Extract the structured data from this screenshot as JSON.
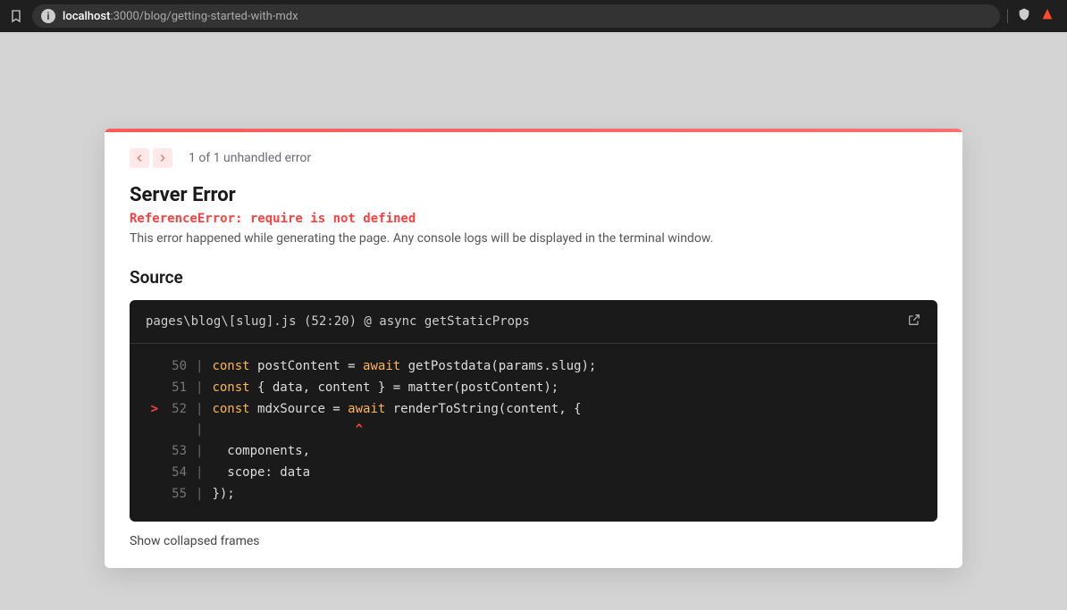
{
  "browser": {
    "url_host": "localhost",
    "url_port": ":3000",
    "url_path": "/blog/getting-started-with-mdx"
  },
  "nav": {
    "count_text": "1 of 1 unhandled error"
  },
  "error": {
    "title": "Server Error",
    "message": "ReferenceError: require is not defined",
    "description": "This error happened while generating the page. Any console logs will be displayed in the terminal window."
  },
  "source": {
    "title": "Source",
    "location": "pages\\blog\\[slug].js (52:20) @ async getStaticProps",
    "lines": [
      {
        "mark": "",
        "num": "50",
        "html": "<span class='kw'>const</span> postContent = <span class='kw'>await</span> getPostdata(params.slug);"
      },
      {
        "mark": "",
        "num": "51",
        "html": "<span class='kw'>const</span> { data, content } = matter(postContent);"
      },
      {
        "mark": ">",
        "num": "52",
        "html": "<span class='kw'>const</span> mdxSource = <span class='kw'>await</span> renderToString(content, {"
      },
      {
        "mark": "",
        "num": "",
        "html": "                   <span style='color:#ff4040;font-weight:bold'>^</span>"
      },
      {
        "mark": "",
        "num": "53",
        "html": "  components,"
      },
      {
        "mark": "",
        "num": "54",
        "html": "  scope: data"
      },
      {
        "mark": "",
        "num": "55",
        "html": "});"
      }
    ],
    "collapsed_text": "Show collapsed frames"
  }
}
